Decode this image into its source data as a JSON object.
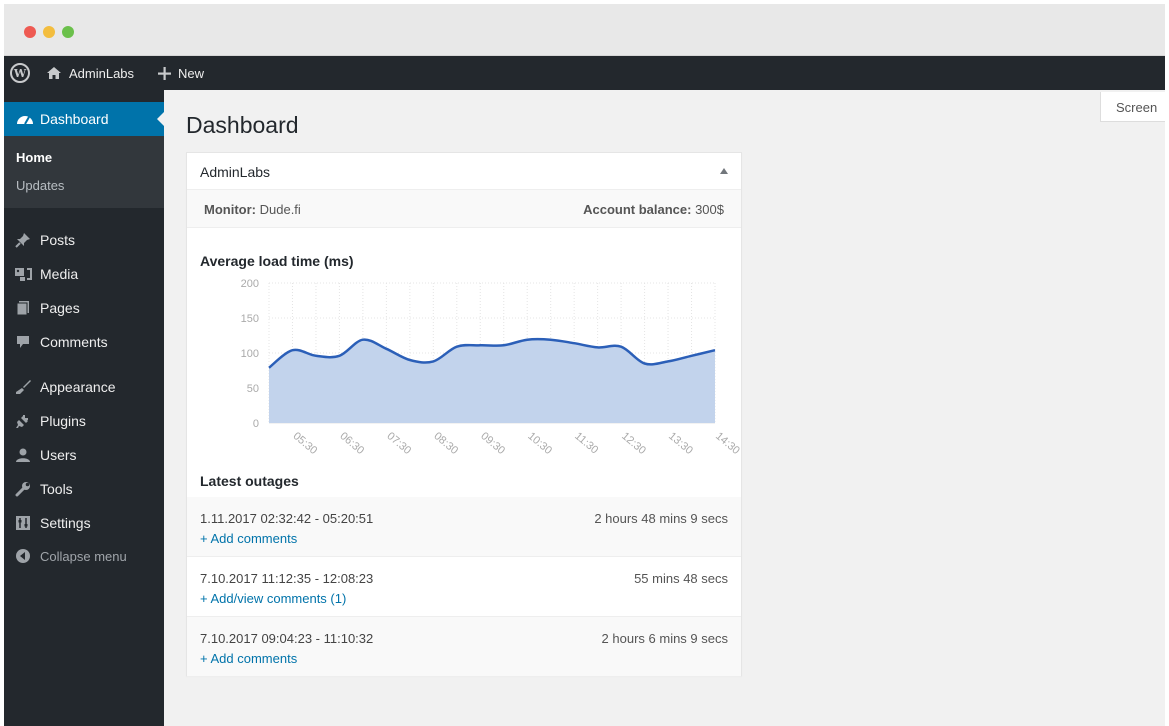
{
  "adminbar": {
    "site_label": "AdminLabs",
    "new_label": "New"
  },
  "sidebar": {
    "dashboard_label": "Dashboard",
    "submenu": [
      "Home",
      "Updates"
    ],
    "items": [
      {
        "label": "Posts",
        "icon": "pin-icon"
      },
      {
        "label": "Media",
        "icon": "media-icon"
      },
      {
        "label": "Pages",
        "icon": "pages-icon"
      },
      {
        "label": "Comments",
        "icon": "comments-icon"
      },
      {
        "label": "Appearance",
        "icon": "brush-icon"
      },
      {
        "label": "Plugins",
        "icon": "plugin-icon"
      },
      {
        "label": "Users",
        "icon": "user-icon"
      },
      {
        "label": "Tools",
        "icon": "wrench-icon"
      },
      {
        "label": "Settings",
        "icon": "settings-icon"
      }
    ],
    "collapse_label": "Collapse menu"
  },
  "page": {
    "title": "Dashboard",
    "screen_options": "Screen"
  },
  "widget": {
    "title": "AdminLabs",
    "monitor_label": "Monitor:",
    "monitor_value": "Dude.fi",
    "balance_label": "Account balance:",
    "balance_value": "300$",
    "chart_title": "Average load time (ms)",
    "outages_title": "Latest outages",
    "outages": [
      {
        "range": "1.11.2017 02:32:42 - 05:20:51",
        "duration": "2 hours 48 mins 9 secs",
        "link": "+ Add comments"
      },
      {
        "range": "7.10.2017 11:12:35 - 12:08:23",
        "duration": "55 mins 48 secs",
        "link": "+ Add/view comments (1)"
      },
      {
        "range": "7.10.2017 09:04:23 - 11:10:32",
        "duration": "2 hours 6 mins 9 secs",
        "link": "+ Add comments"
      }
    ]
  },
  "colors": {
    "accent": "#0073aa",
    "line": "#2b5fb8",
    "fill": "#c2d3ec"
  },
  "chart_data": {
    "type": "area",
    "title": "Average load time (ms)",
    "ylim": [
      0,
      200
    ],
    "yticks": [
      0,
      50,
      100,
      150,
      200
    ],
    "xticks": [
      "05:30",
      "06:30",
      "07:30",
      "08:30",
      "09:30",
      "10:30",
      "11:30",
      "12:30",
      "13:30",
      "14:30"
    ],
    "x_hours": [
      5.0,
      5.5,
      6.0,
      6.5,
      7.0,
      7.5,
      8.0,
      8.5,
      9.0,
      9.5,
      10.0,
      10.5,
      11.0,
      11.5,
      12.0,
      12.5,
      13.0,
      13.5,
      14.0,
      14.5
    ],
    "values": [
      79,
      104,
      96,
      96,
      119,
      106,
      90,
      88,
      109,
      111,
      111,
      119,
      119,
      114,
      108,
      109,
      85,
      88,
      96,
      104
    ],
    "grid": true,
    "legend": "none"
  }
}
